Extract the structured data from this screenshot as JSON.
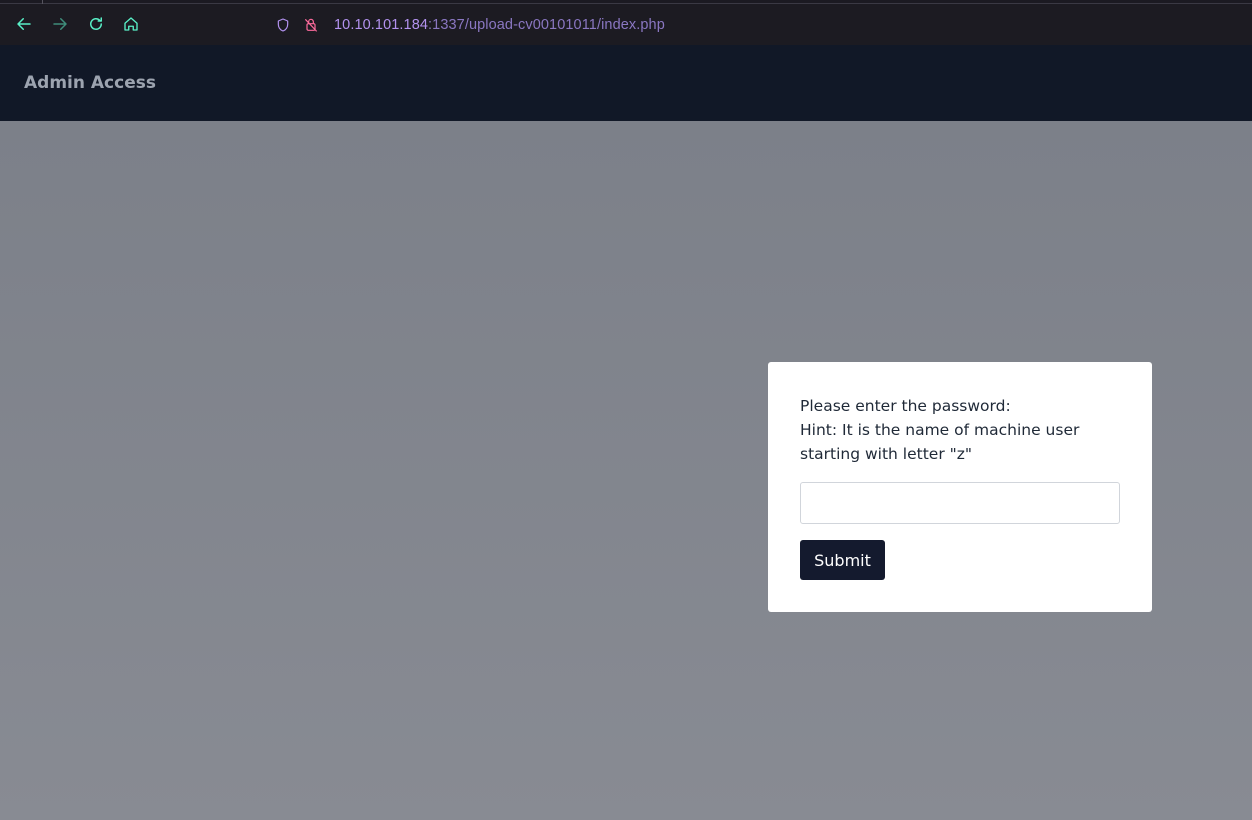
{
  "browser": {
    "url_host": "10.10.101.184",
    "url_rest": ":1337/upload-cv00101011/index.php",
    "icons": {
      "back": "arrow-left-icon",
      "forward": "arrow-right-icon",
      "reload": "reload-icon",
      "home": "home-icon",
      "tracking": "shield-icon",
      "connection": "insecure-lock-icon"
    },
    "colors": {
      "chrome_bg": "#1c1b22",
      "icon_active": "#59f0c7",
      "icon_disabled": "#3f8d7b",
      "url_purple": "#b392f0"
    }
  },
  "header": {
    "title": "Admin Access",
    "bg_color": "#111827"
  },
  "form": {
    "prompt_line1": "Please enter the password:",
    "prompt_line2": "Hint: It is the name of machine user starting with letter \"z\"",
    "password_value": "",
    "submit_label": "Submit",
    "button_color": "#141a2e"
  }
}
